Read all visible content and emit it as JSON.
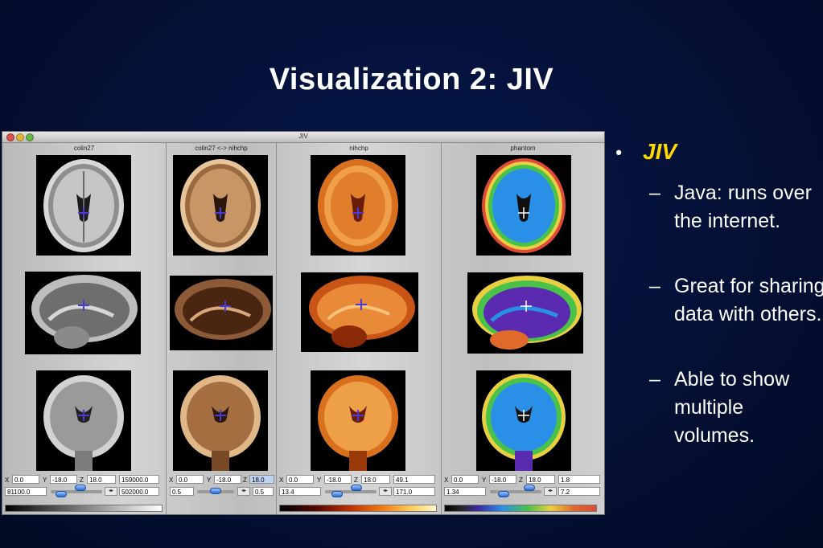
{
  "slide": {
    "title": "Visualization 2: JIV"
  },
  "window": {
    "title": "JIV",
    "panels": [
      {
        "title": "colin27",
        "x": "0.0",
        "y": "-18.0",
        "z": "18.0",
        "value": "159000.0",
        "min": "81100.0",
        "max": "502000.0",
        "colormap": "gray"
      },
      {
        "title": "colin27 <-> nihchp",
        "x": "0.0",
        "y": "-18.0",
        "z": "18.0",
        "min": "0.5",
        "max": "0.5",
        "colormap": "blend"
      },
      {
        "title": "nihchp",
        "x": "0.0",
        "y": "-18.0",
        "z": "18.0",
        "value": "49.1",
        "min": "13.4",
        "max": "171.0",
        "colormap": "hot"
      },
      {
        "title": "phantom",
        "x": "0.0",
        "y": "-18.0",
        "z": "18.0",
        "value": "1.8",
        "min": "1.34",
        "max": "7.2",
        "colormap": "spectral"
      }
    ],
    "labels": {
      "x": "X",
      "y": "Y",
      "z": "Z"
    }
  },
  "bullets": {
    "main": "JIV",
    "items": [
      {
        "dash": "–",
        "text": "Java: runs over the internet."
      },
      {
        "dash": "–",
        "text": "Great for sharing data with others."
      },
      {
        "dash": "–",
        "text": "Able to show multiple volumes."
      }
    ],
    "colors": {
      "main": "#ffd800",
      "text": "#ffffff"
    }
  },
  "colors": {
    "background": "#041036",
    "title": "#ffffff"
  }
}
